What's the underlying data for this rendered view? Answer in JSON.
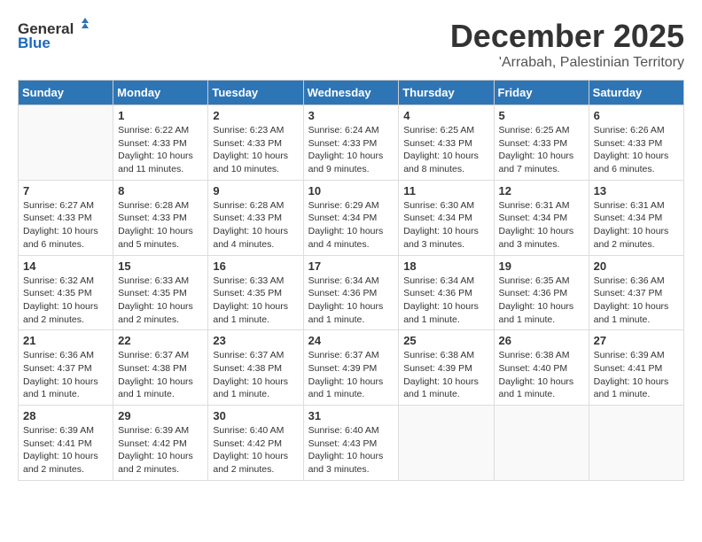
{
  "logo": {
    "general": "General",
    "blue": "Blue"
  },
  "title": {
    "month": "December 2025",
    "location": "'Arrabah, Palestinian Territory"
  },
  "weekdays": [
    "Sunday",
    "Monday",
    "Tuesday",
    "Wednesday",
    "Thursday",
    "Friday",
    "Saturday"
  ],
  "weeks": [
    [
      {
        "day": "",
        "info": ""
      },
      {
        "day": "1",
        "info": "Sunrise: 6:22 AM\nSunset: 4:33 PM\nDaylight: 10 hours\nand 11 minutes."
      },
      {
        "day": "2",
        "info": "Sunrise: 6:23 AM\nSunset: 4:33 PM\nDaylight: 10 hours\nand 10 minutes."
      },
      {
        "day": "3",
        "info": "Sunrise: 6:24 AM\nSunset: 4:33 PM\nDaylight: 10 hours\nand 9 minutes."
      },
      {
        "day": "4",
        "info": "Sunrise: 6:25 AM\nSunset: 4:33 PM\nDaylight: 10 hours\nand 8 minutes."
      },
      {
        "day": "5",
        "info": "Sunrise: 6:25 AM\nSunset: 4:33 PM\nDaylight: 10 hours\nand 7 minutes."
      },
      {
        "day": "6",
        "info": "Sunrise: 6:26 AM\nSunset: 4:33 PM\nDaylight: 10 hours\nand 6 minutes."
      }
    ],
    [
      {
        "day": "7",
        "info": "Sunrise: 6:27 AM\nSunset: 4:33 PM\nDaylight: 10 hours\nand 6 minutes."
      },
      {
        "day": "8",
        "info": "Sunrise: 6:28 AM\nSunset: 4:33 PM\nDaylight: 10 hours\nand 5 minutes."
      },
      {
        "day": "9",
        "info": "Sunrise: 6:28 AM\nSunset: 4:33 PM\nDaylight: 10 hours\nand 4 minutes."
      },
      {
        "day": "10",
        "info": "Sunrise: 6:29 AM\nSunset: 4:34 PM\nDaylight: 10 hours\nand 4 minutes."
      },
      {
        "day": "11",
        "info": "Sunrise: 6:30 AM\nSunset: 4:34 PM\nDaylight: 10 hours\nand 3 minutes."
      },
      {
        "day": "12",
        "info": "Sunrise: 6:31 AM\nSunset: 4:34 PM\nDaylight: 10 hours\nand 3 minutes."
      },
      {
        "day": "13",
        "info": "Sunrise: 6:31 AM\nSunset: 4:34 PM\nDaylight: 10 hours\nand 2 minutes."
      }
    ],
    [
      {
        "day": "14",
        "info": "Sunrise: 6:32 AM\nSunset: 4:35 PM\nDaylight: 10 hours\nand 2 minutes."
      },
      {
        "day": "15",
        "info": "Sunrise: 6:33 AM\nSunset: 4:35 PM\nDaylight: 10 hours\nand 2 minutes."
      },
      {
        "day": "16",
        "info": "Sunrise: 6:33 AM\nSunset: 4:35 PM\nDaylight: 10 hours\nand 1 minute."
      },
      {
        "day": "17",
        "info": "Sunrise: 6:34 AM\nSunset: 4:36 PM\nDaylight: 10 hours\nand 1 minute."
      },
      {
        "day": "18",
        "info": "Sunrise: 6:34 AM\nSunset: 4:36 PM\nDaylight: 10 hours\nand 1 minute."
      },
      {
        "day": "19",
        "info": "Sunrise: 6:35 AM\nSunset: 4:36 PM\nDaylight: 10 hours\nand 1 minute."
      },
      {
        "day": "20",
        "info": "Sunrise: 6:36 AM\nSunset: 4:37 PM\nDaylight: 10 hours\nand 1 minute."
      }
    ],
    [
      {
        "day": "21",
        "info": "Sunrise: 6:36 AM\nSunset: 4:37 PM\nDaylight: 10 hours\nand 1 minute."
      },
      {
        "day": "22",
        "info": "Sunrise: 6:37 AM\nSunset: 4:38 PM\nDaylight: 10 hours\nand 1 minute."
      },
      {
        "day": "23",
        "info": "Sunrise: 6:37 AM\nSunset: 4:38 PM\nDaylight: 10 hours\nand 1 minute."
      },
      {
        "day": "24",
        "info": "Sunrise: 6:37 AM\nSunset: 4:39 PM\nDaylight: 10 hours\nand 1 minute."
      },
      {
        "day": "25",
        "info": "Sunrise: 6:38 AM\nSunset: 4:39 PM\nDaylight: 10 hours\nand 1 minute."
      },
      {
        "day": "26",
        "info": "Sunrise: 6:38 AM\nSunset: 4:40 PM\nDaylight: 10 hours\nand 1 minute."
      },
      {
        "day": "27",
        "info": "Sunrise: 6:39 AM\nSunset: 4:41 PM\nDaylight: 10 hours\nand 1 minute."
      }
    ],
    [
      {
        "day": "28",
        "info": "Sunrise: 6:39 AM\nSunset: 4:41 PM\nDaylight: 10 hours\nand 2 minutes."
      },
      {
        "day": "29",
        "info": "Sunrise: 6:39 AM\nSunset: 4:42 PM\nDaylight: 10 hours\nand 2 minutes."
      },
      {
        "day": "30",
        "info": "Sunrise: 6:40 AM\nSunset: 4:42 PM\nDaylight: 10 hours\nand 2 minutes."
      },
      {
        "day": "31",
        "info": "Sunrise: 6:40 AM\nSunset: 4:43 PM\nDaylight: 10 hours\nand 3 minutes."
      },
      {
        "day": "",
        "info": ""
      },
      {
        "day": "",
        "info": ""
      },
      {
        "day": "",
        "info": ""
      }
    ]
  ]
}
